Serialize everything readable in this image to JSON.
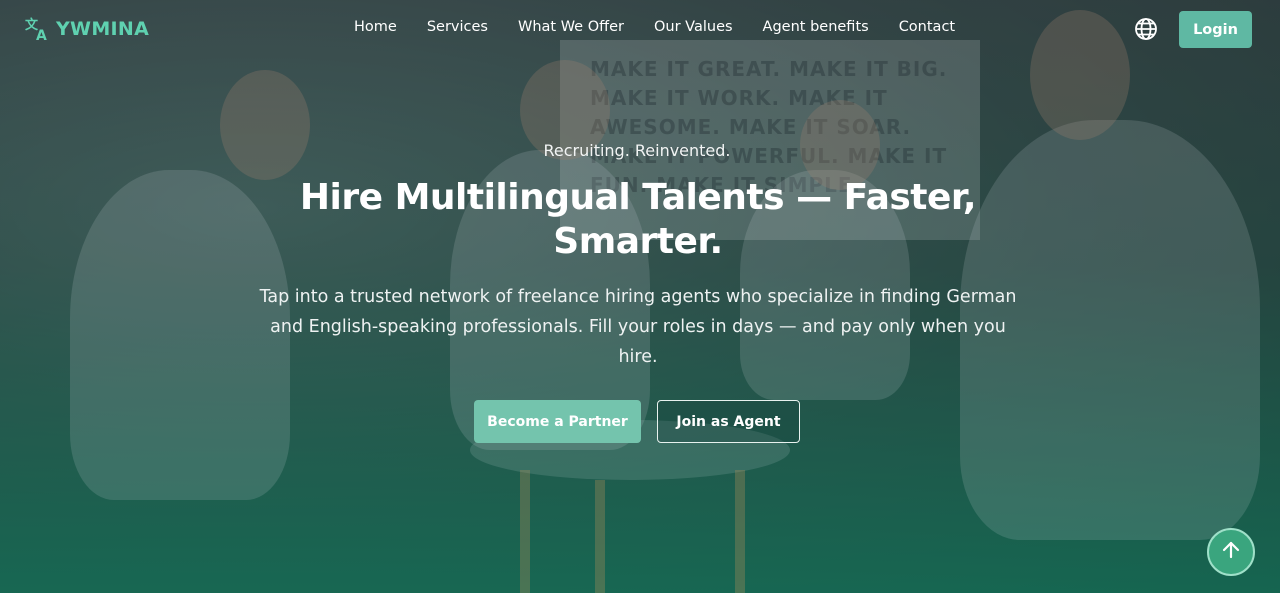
{
  "brand": {
    "name": "YWMINA",
    "icon": "translate-icon",
    "color": "#5fd1b0"
  },
  "nav": {
    "items": [
      {
        "label": "Home"
      },
      {
        "label": "Services"
      },
      {
        "label": "What We Offer"
      },
      {
        "label": "Our Values"
      },
      {
        "label": "Agent benefits"
      },
      {
        "label": "Contact"
      }
    ],
    "language_icon": "globe-icon",
    "login_label": "Login"
  },
  "hero": {
    "eyebrow": "Recruiting. Reinvented.",
    "headline": "Hire Multilingual Talents — Faster, Smarter.",
    "subtext": "Tap into a trusted network of freelance hiring agents who specialize in finding German and English-speaking professionals. Fill your roles in days — and pay only when you hire.",
    "primary_cta": "Become a Partner",
    "secondary_cta": "Join as Agent"
  },
  "background_wall_text": "MAKE IT GREAT. MAKE IT BIG. MAKE IT WORK. MAKE IT AWESOME. MAKE IT SOAR. MAKE IT POWERFUL. MAKE IT FUN. MAKE IT SIMPLE.",
  "scroll_top_icon": "arrow-up-icon",
  "colors": {
    "accent": "#74c4ad",
    "login": "#5fb8a3",
    "scroll_button": "#3aa57e"
  }
}
